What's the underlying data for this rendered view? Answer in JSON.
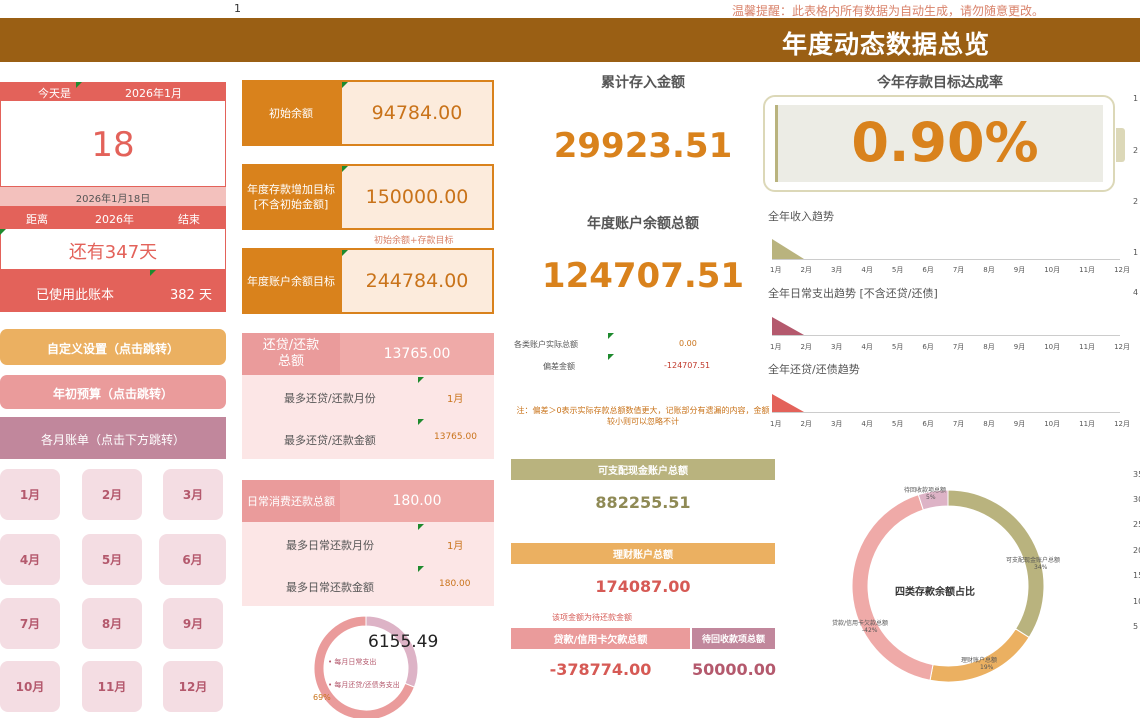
{
  "top": {
    "cell_number": "1",
    "reminder": "温馨提醒：此表格内所有数据为自动生成，请勿随意更改。"
  },
  "banner": {
    "title": "年度动态数据总览"
  },
  "date_panel": {
    "today_label": "今天是",
    "year_month": "2026年1月",
    "day": "18",
    "full_date": "2026年1月18日",
    "dist_label": "距离",
    "dist_year": "2026年",
    "dist_end": "结束",
    "remaining": "还有347天",
    "used_label": "已使用此账本",
    "used_days": "382 天"
  },
  "buttons": {
    "custom": "自定义设置（点击跳转）",
    "budget": "年初预算（点击跳转）",
    "monthly": "各月账单（点击下方跳转）"
  },
  "months": [
    "1月",
    "2月",
    "3月",
    "4月",
    "5月",
    "6月",
    "7月",
    "8月",
    "9月",
    "10月",
    "11月",
    "12月"
  ],
  "balances": {
    "initial_label": "初始余额",
    "initial_value": "94784.00",
    "target_label": "年度存款增加目标\n[不含初始金额]",
    "target_value": "150000.00",
    "note": "初始余额+存款目标",
    "acct_label": "年度账户余额目标",
    "acct_value": "244784.00"
  },
  "repay": {
    "head": "还贷/还款\n总额",
    "value": "13765.00",
    "max_month_label": "最多还贷/还款月份",
    "max_month_value": "1月",
    "max_amount_label": "最多还贷/还款金额",
    "max_amount_value": "13765.00"
  },
  "daily": {
    "head": "日常消费还款总额",
    "value": "180.00",
    "max_month_label": "最多日常还款月份",
    "max_month_value": "1月",
    "max_amount_label": "最多日常还款金额",
    "max_amount_value": "180.00"
  },
  "small_donut": {
    "center": "6155.49",
    "legend1": "• 每月日常支出",
    "legend2": "• 每月还贷/还债务支出",
    "pct": "69%"
  },
  "middle": {
    "deposit_title": "累计存入金额",
    "deposit_value": "29923.51",
    "balance_title": "年度账户余额总额",
    "balance_value": "124707.51",
    "actual_label": "各类账户实际总额",
    "actual_value": "0.00",
    "diff_label": "偏差金额",
    "diff_value": "-124707.51",
    "note": "注：偏差＞0表示实际存款总额数值更大，记账部分有遗漏的内容，金额较小则可以忽略不计"
  },
  "accounts": {
    "disposable_head": "可支配现金账户总额",
    "disposable_value": "882255.51",
    "invest_head": "理财账户总额",
    "invest_value": "174087.00",
    "note": "该项金额为待还款金额",
    "loan_head": "贷款/信用卡欠款总额",
    "loan_value": "-378774.00",
    "receivable_head": "待回收款项总额",
    "receivable_value": "50000.00"
  },
  "goal": {
    "title": "今年存款目标达成率",
    "rate": "0.90%"
  },
  "trends": {
    "income_title": "全年收入趋势",
    "expense_title": "全年日常支出趋势 [不含还贷/还债]",
    "repay_title": "全年还贷/还债趋势",
    "months": [
      "1月",
      "2月",
      "3月",
      "4月",
      "5月",
      "6月",
      "7月",
      "8月",
      "9月",
      "10月",
      "11月",
      "12月"
    ]
  },
  "right_axis": [
    "1",
    "2",
    "2",
    "1",
    "4",
    "35",
    "30",
    "25",
    "20",
    "15",
    "10",
    "5"
  ],
  "donut": {
    "center": "四类存款余额占比",
    "label_receivable": "待回收款项总额",
    "pct_receivable": "5%",
    "label_disposable": "可支配现金账户总额",
    "pct_disposable": "34%",
    "label_invest": "理财账户总额",
    "pct_invest": "19%",
    "label_loan": "贷款/信用卡欠款总额",
    "pct_loan": "-42%"
  },
  "chart_data": [
    {
      "type": "pie",
      "title": "四类存款余额占比",
      "categories": [
        "可支配现金账户总额",
        "理财账户总额",
        "贷款/信用卡欠款总额",
        "待回收款项总额"
      ],
      "values": [
        34,
        19,
        42,
        5
      ],
      "colors": [
        "#b9b37e",
        "#ebb061",
        "#efaaa8",
        "#ddb3c6"
      ]
    },
    {
      "type": "pie",
      "categories": [
        "每月日常支出",
        "每月还贷/还债务支出"
      ],
      "values": [
        31,
        69
      ],
      "colors": [
        "#ddb3c6",
        "#ea9b9b"
      ]
    }
  ]
}
